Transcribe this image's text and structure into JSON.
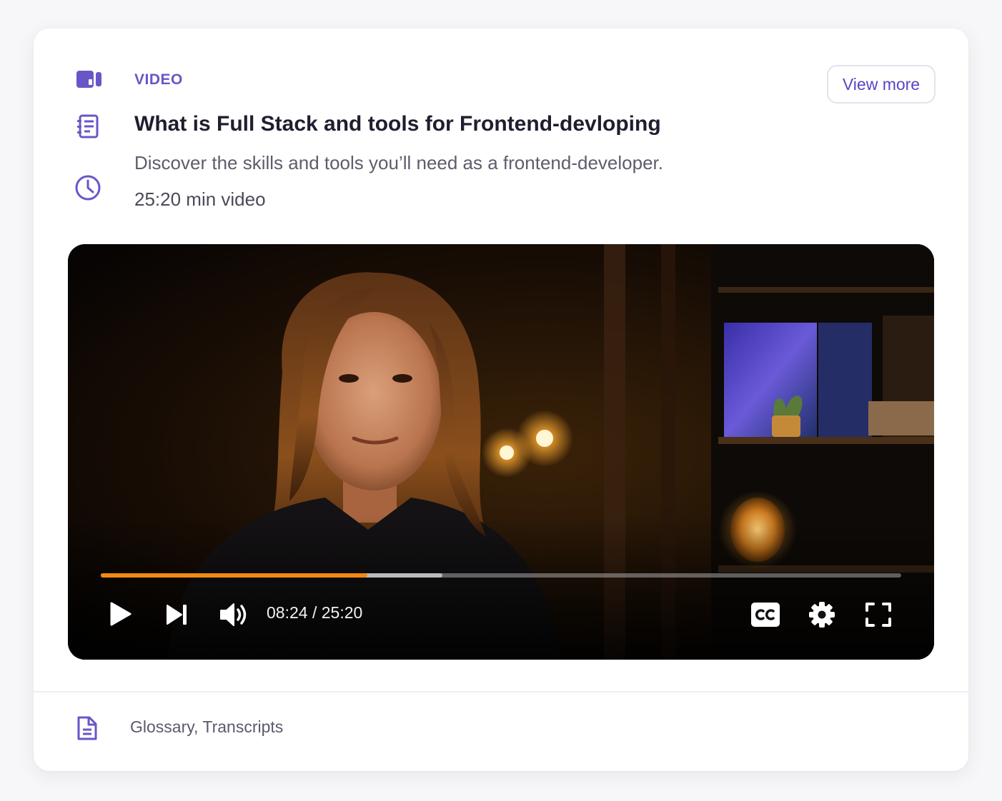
{
  "card": {
    "tag": "VIDEO",
    "title": "What is Full Stack and tools for Frontend-devloping",
    "subtitle": "Discover the skills and tools you’ll need as a frontend-developer.",
    "duration": "25:20 min video",
    "view_more_label": "View more",
    "icons": [
      "video-camera-icon",
      "notebook-icon",
      "clock-icon"
    ]
  },
  "player": {
    "current_time": "08:24",
    "separator": "/",
    "total_time": "25:20",
    "progress_fraction": 0.333,
    "buffered_fraction": 0.427,
    "controls": [
      "play-icon",
      "skip-next-icon",
      "volume-icon",
      "cc-icon",
      "settings-icon",
      "fullscreen-icon"
    ],
    "accent_color": "#f08a12"
  },
  "footer": {
    "resources_label": "Glossary, Transcripts",
    "icon": "document-icon"
  },
  "colors": {
    "brand": "#6a55c8",
    "title": "#1e1e2e",
    "body_text": "#5d5d6c"
  }
}
